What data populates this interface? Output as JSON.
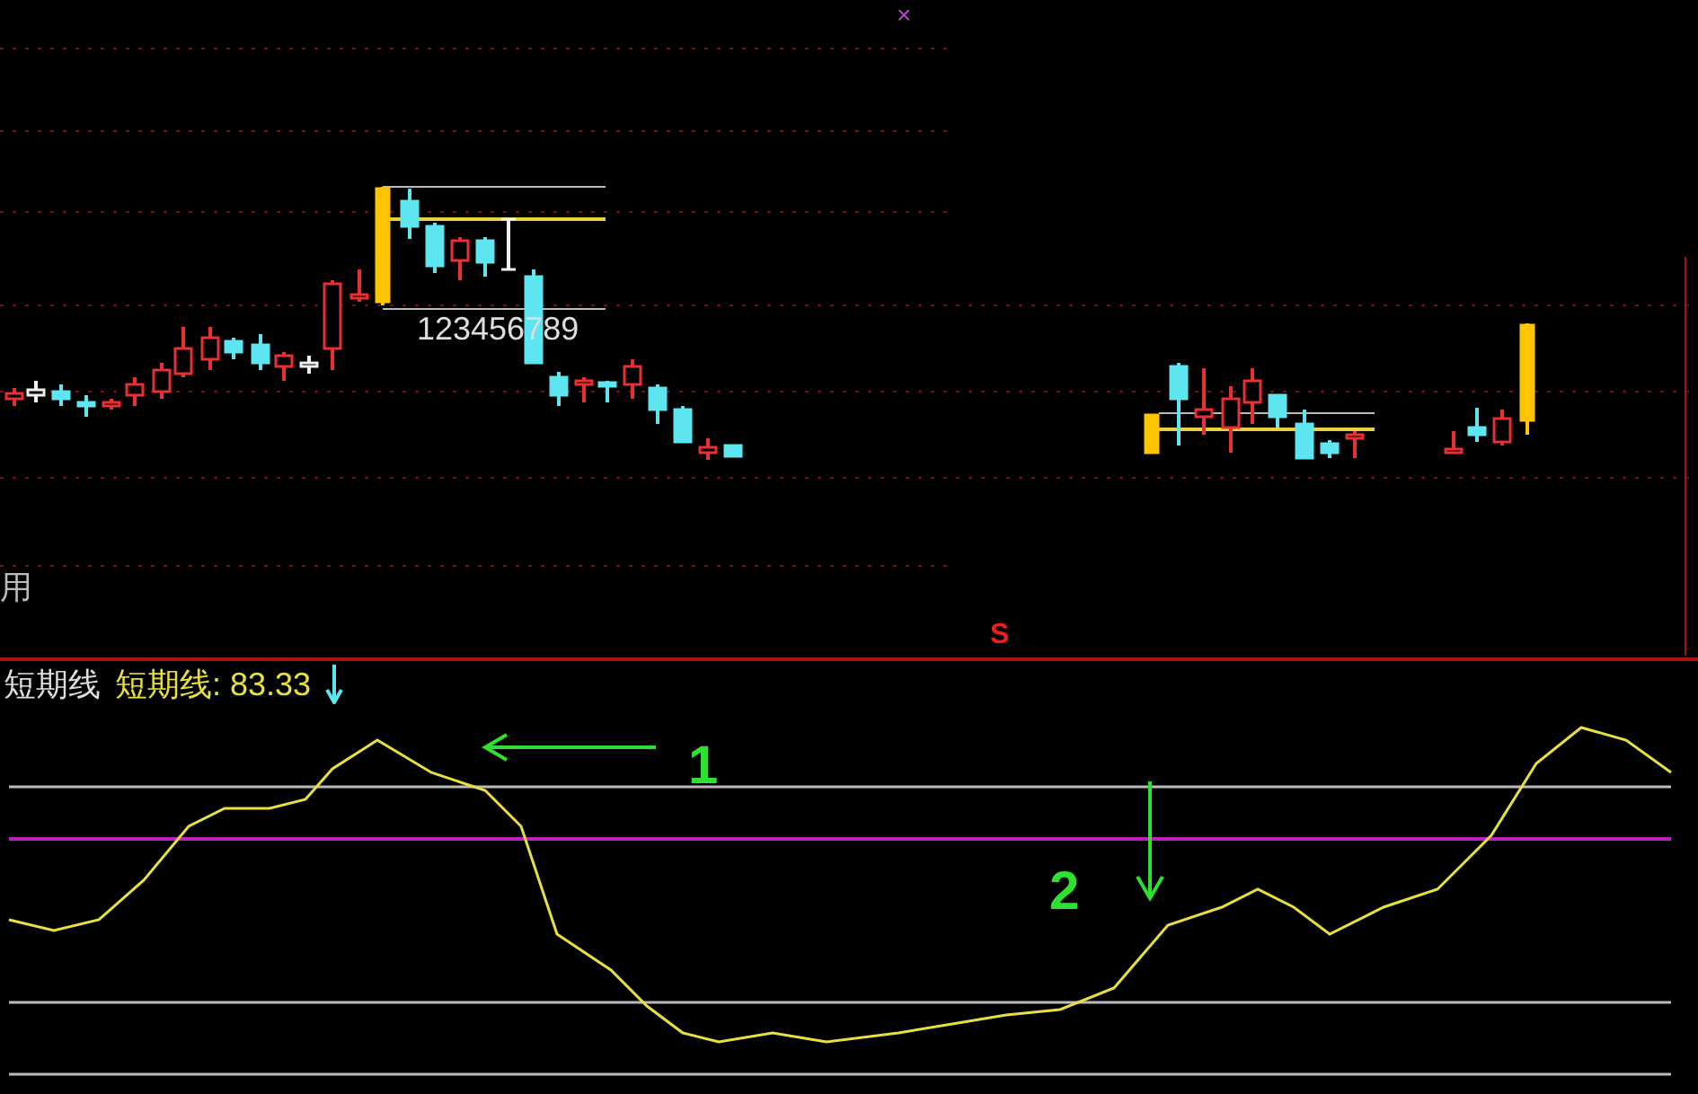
{
  "price_panel": {
    "marker": "×",
    "pattern_label": "123456789",
    "left_label": "用",
    "signal": "S"
  },
  "indicator_panel": {
    "name": "短期线",
    "value_label": "短期线: 83.33",
    "annotations": [
      {
        "label": "1",
        "kind": "left"
      },
      {
        "label": "2",
        "kind": "down"
      }
    ]
  }
}
